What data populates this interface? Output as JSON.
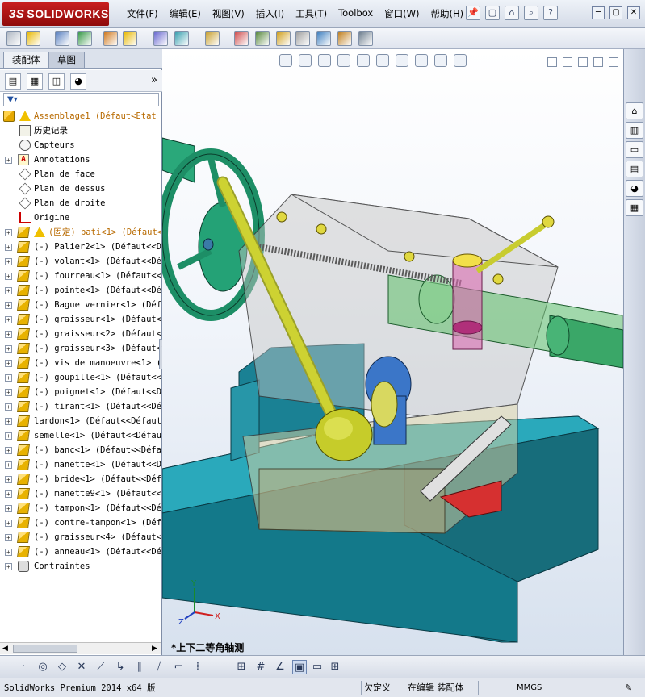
{
  "app": {
    "brand": "SOLIDWORKS",
    "brand_prefix": "3S",
    "menu": [
      "文件(F)",
      "编辑(E)",
      "视图(V)",
      "插入(I)",
      "工具(T)",
      "Toolbox",
      "窗口(W)",
      "帮助(H)"
    ]
  },
  "left_panel": {
    "tabs": [
      "装配体",
      "草图"
    ],
    "filter_icon": "funnel-icon",
    "tree": [
      {
        "label": "Assemblage1  (Défaut<Etat",
        "icon": "assembly-icon",
        "warn": true,
        "root": true
      },
      {
        "label": "历史记录",
        "icon": "history-icon"
      },
      {
        "label": "Capteurs",
        "icon": "sensor-icon"
      },
      {
        "label": "Annotations",
        "icon": "annotation-icon",
        "expand": true
      },
      {
        "label": "Plan de face",
        "icon": "plane-icon"
      },
      {
        "label": "Plan de dessus",
        "icon": "plane-icon"
      },
      {
        "label": "Plan de droite",
        "icon": "plane-icon"
      },
      {
        "label": "Origine",
        "icon": "origin-icon"
      },
      {
        "label": "(固定) bati<1> (Défaut<",
        "icon": "part-icon",
        "expand": true,
        "warn": true,
        "orange": true
      },
      {
        "label": "(-) Palier2<1> (Défaut<<Dé",
        "icon": "part-icon",
        "expand": true
      },
      {
        "label": "(-) volant<1> (Défaut<<Déf",
        "icon": "part-icon",
        "expand": true
      },
      {
        "label": "(-) fourreau<1> (Défaut<<D",
        "icon": "part-icon",
        "expand": true
      },
      {
        "label": "(-) pointe<1> (Défaut<<Déf",
        "icon": "part-icon",
        "expand": true
      },
      {
        "label": "(-) Bague vernier<1> (Défa",
        "icon": "part-icon",
        "expand": true
      },
      {
        "label": "(-) graisseur<1> (Défaut<<",
        "icon": "part-icon",
        "expand": true
      },
      {
        "label": "(-) graisseur<2> (Défaut<<",
        "icon": "part-icon",
        "expand": true
      },
      {
        "label": "(-) graisseur<3> (Défaut<<",
        "icon": "part-icon",
        "expand": true
      },
      {
        "label": "(-) vis de manoeuvre<1> (D",
        "icon": "part-icon",
        "expand": true
      },
      {
        "label": "(-) goupille<1> (Défaut<<D",
        "icon": "part-icon",
        "expand": true
      },
      {
        "label": "(-) poignet<1> (Défaut<<Dé",
        "icon": "part-icon",
        "expand": true
      },
      {
        "label": "(-) tirant<1> (Défaut<<Déf",
        "icon": "part-icon",
        "expand": true
      },
      {
        "label": "lardon<1> (Défaut<<Défaut>",
        "icon": "part-icon",
        "expand": true
      },
      {
        "label": "semelle<1> (Défaut<<Défaut",
        "icon": "part-icon",
        "expand": true
      },
      {
        "label": "(-) banc<1> (Défaut<<Défau",
        "icon": "part-icon",
        "expand": true
      },
      {
        "label": "(-) manette<1> (Défaut<<Dé",
        "icon": "part-icon",
        "expand": true
      },
      {
        "label": "(-) bride<1> (Défaut<<Défa",
        "icon": "part-icon",
        "expand": true
      },
      {
        "label": "(-) manette9<1> (Défaut<<D",
        "icon": "part-icon",
        "expand": true
      },
      {
        "label": "(-) tampon<1> (Défaut<<Déf",
        "icon": "part-icon",
        "expand": true
      },
      {
        "label": "(-) contre-tampon<1> (Défa",
        "icon": "part-icon",
        "expand": true
      },
      {
        "label": "(-) graisseur<4> (Défaut<<",
        "icon": "part-icon",
        "expand": true
      },
      {
        "label": "(-) anneau<1> (Défaut<<Déf",
        "icon": "part-icon",
        "expand": true
      },
      {
        "label": "Contraintes",
        "icon": "mates-icon",
        "expand": true
      }
    ]
  },
  "viewport": {
    "view_name": "*上下二等角轴测",
    "triad": {
      "x": "X",
      "y": "Y",
      "z": "Z"
    }
  },
  "status": {
    "product": "SolidWorks Premium 2014 x64 版",
    "defined": "欠定义",
    "editing": "在编辑 装配体",
    "units": "MMGS",
    "help_icon": "help-icon"
  },
  "colors": {
    "teal_base": "#1a8fa0",
    "housing_translucent": "#c9c9c9",
    "lever_yellow": "#c8cc30",
    "wheel_green": "#2aa87a"
  }
}
